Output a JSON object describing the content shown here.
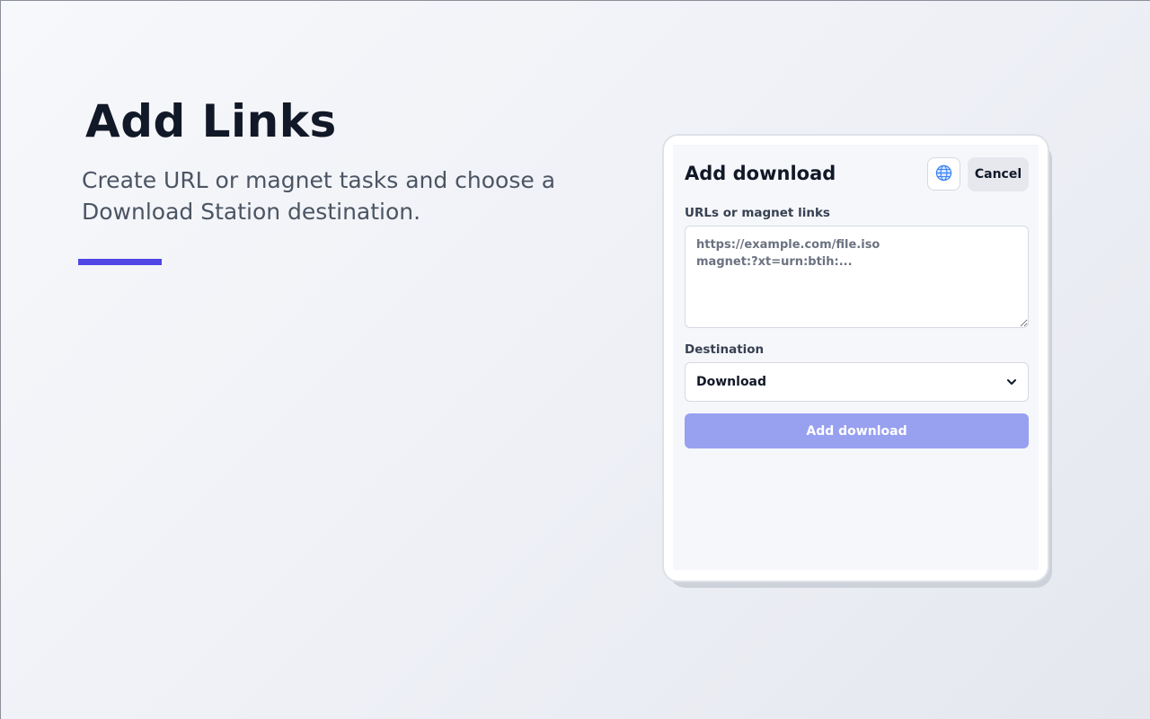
{
  "hero": {
    "title": "Add Links",
    "subtitle": "Create URL or magnet tasks and choose a Download Station destination."
  },
  "dialog": {
    "title": "Add download",
    "globe_icon": "globe-icon",
    "cancel_label": "Cancel",
    "urls_label": "URLs or magnet links",
    "urls_placeholder": "https://example.com/file.iso\nmagnet:?xt=urn:btih:...",
    "urls_value": "",
    "destination_label": "Destination",
    "destination_value": "Download",
    "submit_label": "Add download"
  },
  "colors": {
    "accent": "#4f46e5",
    "submit_disabled": "#98a0f0",
    "globe": "#3b82f6"
  }
}
